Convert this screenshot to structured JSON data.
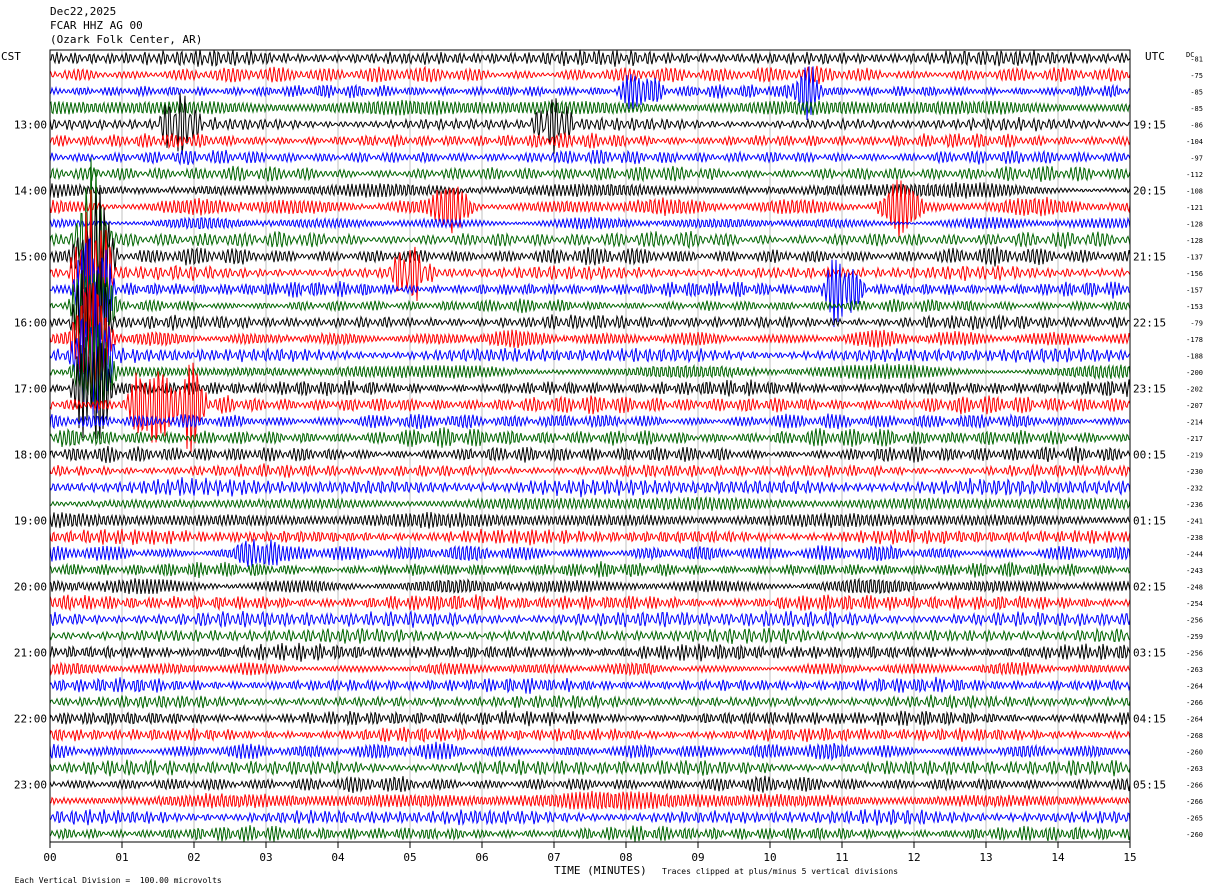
{
  "header": {
    "date": "Dec22,2025",
    "station": "FCAR HHZ AG 00",
    "location": "(Ozark Folk Center, AR)"
  },
  "left_zone": "CST",
  "right_zone": "UTC",
  "dc_label": "DC",
  "footer": {
    "left": "Each Vertical Division =  100.00 microvolts",
    "center": "TIME (MINUTES)",
    "right": "Traces clipped at plus/minus 5 vertical divisions"
  },
  "chart_data": {
    "type": "line",
    "title": "",
    "xlabel": "TIME (MINUTES)",
    "ylabel": "",
    "xlim": [
      0,
      15
    ],
    "x_ticks": [
      "00",
      "01",
      "02",
      "03",
      "04",
      "05",
      "06",
      "07",
      "08",
      "09",
      "10",
      "11",
      "12",
      "13",
      "14",
      "15"
    ],
    "rows": 48,
    "row_interval_minutes": 15,
    "trace_colors": [
      "#000000",
      "#ff0000",
      "#0000ff",
      "#006400"
    ],
    "left_hour_labels": [
      "13:00",
      "14:00",
      "15:00",
      "16:00",
      "17:00",
      "18:00",
      "19:00",
      "20:00",
      "21:00",
      "22:00",
      "23:00"
    ],
    "right_hour_labels": [
      "19:15",
      "20:15",
      "21:15",
      "22:15",
      "23:15",
      "00:15",
      "01:15",
      "02:15",
      "03:15",
      "04:15",
      "05:15"
    ],
    "dc_offsets": [
      "-81",
      "-75",
      "-85",
      "-85",
      "-86",
      "-104",
      "-97",
      "-112",
      "-108",
      "-121",
      "-128",
      "-128",
      "-137",
      "-156",
      "-157",
      "-153",
      "-79",
      "-178",
      "-188",
      "-200",
      "-202",
      "-207",
      "-214",
      "-217",
      "-219",
      "-230",
      "-232",
      "-236",
      "-241",
      "-238",
      "-244",
      "-243",
      "-248",
      "-254",
      "-256",
      "-259",
      "-256",
      "-263",
      "-264",
      "-266",
      "-264",
      "-268",
      "-260",
      "-263",
      "-266",
      "-266",
      "-265",
      "-260"
    ],
    "events": [
      {
        "row": 4,
        "minute": 1.8,
        "amplitude": 2.2
      },
      {
        "row": 2,
        "minute": 8.2,
        "amplitude": 1.4
      },
      {
        "row": 2,
        "minute": 10.5,
        "amplitude": 1.6
      },
      {
        "row": 4,
        "minute": 7.0,
        "amplitude": 1.6
      },
      {
        "row": 11,
        "minute": 0.6,
        "amplitude": 4.5
      },
      {
        "row": 12,
        "minute": 0.6,
        "amplitude": 5
      },
      {
        "row": 13,
        "minute": 0.6,
        "amplitude": 5
      },
      {
        "row": 14,
        "minute": 0.6,
        "amplitude": 5
      },
      {
        "row": 15,
        "minute": 0.6,
        "amplitude": 5
      },
      {
        "row": 16,
        "minute": 0.6,
        "amplitude": 5
      },
      {
        "row": 17,
        "minute": 0.6,
        "amplitude": 5
      },
      {
        "row": 18,
        "minute": 0.6,
        "amplitude": 5
      },
      {
        "row": 19,
        "minute": 0.6,
        "amplitude": 5
      },
      {
        "row": 20,
        "minute": 0.6,
        "amplitude": 5
      },
      {
        "row": 13,
        "minute": 5.0,
        "amplitude": 2.0
      },
      {
        "row": 14,
        "minute": 11.0,
        "amplitude": 2.5
      },
      {
        "row": 21,
        "minute": 1.4,
        "amplitude": 3.5
      },
      {
        "row": 21,
        "minute": 1.9,
        "amplitude": 3.0
      },
      {
        "row": 9,
        "minute": 5.6,
        "amplitude": 1.5
      },
      {
        "row": 9,
        "minute": 11.8,
        "amplitude": 1.6
      },
      {
        "row": 30,
        "minute": 2.9,
        "amplitude": 1.5
      }
    ]
  }
}
